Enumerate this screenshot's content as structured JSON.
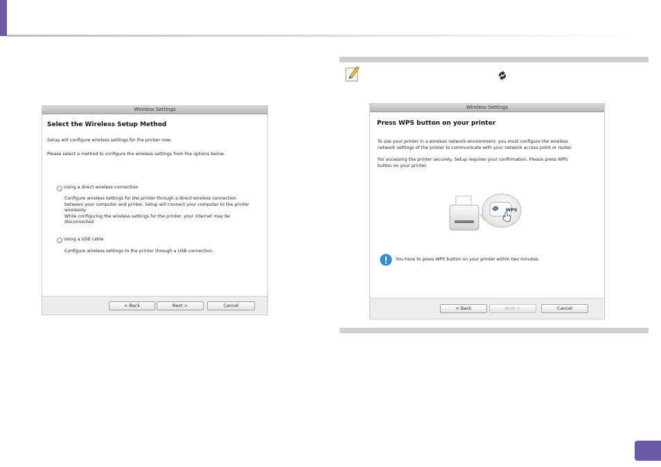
{
  "left_dialog": {
    "title": "Wireless Settings",
    "heading": "Select the Wireless Setup Method",
    "intro_line1": "Setup will configure wireless settings for the printer now.",
    "intro_line2": "Please select a method to configure the wireless settings from the options below.",
    "options": [
      {
        "label": "Using a direct wireless connection",
        "desc": [
          "Configure wireless settings for the printer through a direct wireless connection",
          "between your computer and printer. Setup will connect your computer to the printer",
          "wirelessly.",
          "While configuring the wireless settings for the printer, your internet may be",
          "disconnected."
        ]
      },
      {
        "label": "Using a USB cable",
        "desc": [
          "Configure wireless settings to the printer through a USB connection"
        ]
      }
    ],
    "buttons": {
      "back": "< Back",
      "next": "Next >",
      "cancel": "Cancel"
    }
  },
  "right_dialog": {
    "title": "Wireless Settings",
    "heading": "Press WPS button on your printer",
    "para1_line1": "To use your printer in a wireless network environment, you must configure the wireless",
    "para1_line2": "network settings of the printer to communicate with your network access point or router.",
    "para2_line1": "For accessing the printer securely, Setup requires your confirmation. Please press WPS",
    "para2_line2": "button on your printer.",
    "wps_label": "WPS",
    "info_text": "You have to press WPS button on your printer within two minutes.",
    "buttons": {
      "back": "< Back",
      "next": "Next >",
      "cancel": "Cancel"
    }
  },
  "colors": {
    "accent": "#6a5aa6",
    "info_blue": "#2f8fdc"
  }
}
